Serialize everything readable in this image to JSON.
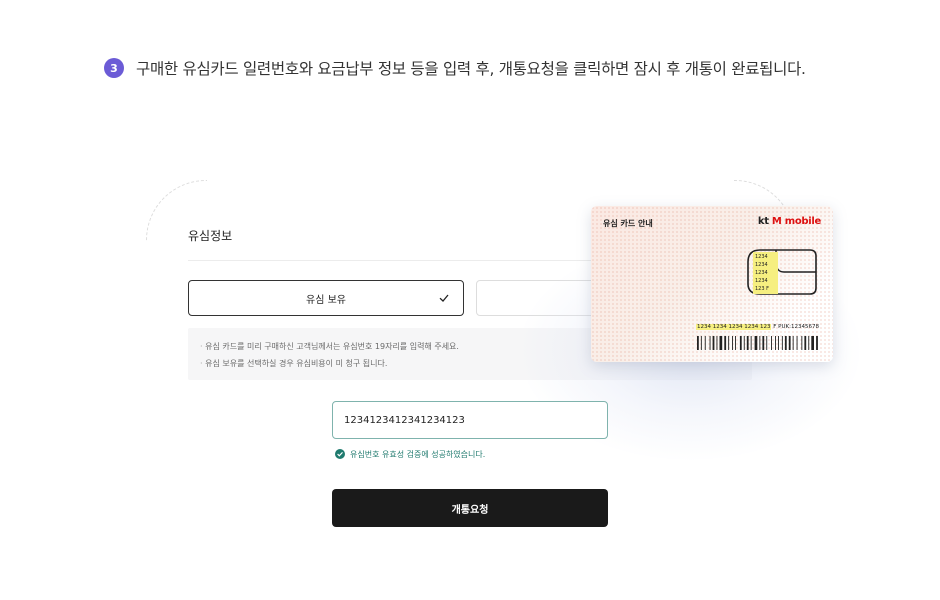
{
  "step": {
    "number": "3",
    "text": "구매한 유심카드 일련번호와 요금납부 정보 등을 입력 후, 개통요청을 클릭하면 잠시 후 개통이 완료됩니다."
  },
  "panel": {
    "title": "유심정보",
    "options": [
      {
        "label": "유심 보유",
        "selected": true
      },
      {
        "label": "",
        "selected": false
      }
    ],
    "notices": [
      "유심 카드를 미리 구매하신 고객님께서는 유심번호 19자리를 입력해 주세요.",
      "유심 보유를 선택하실 경우 유심비용이 미 청구 됩니다."
    ]
  },
  "sim_input": {
    "value": "1234123412341234123"
  },
  "validation": {
    "message": "유심번호 유효성 검증에 성공하였습니다."
  },
  "submit": {
    "label": "개통요청"
  },
  "card": {
    "title": "유심 카드 안내",
    "brand_kt": "kt",
    "brand_name": "M mobile",
    "chip_numbers": [
      "1234",
      "1234",
      "1234",
      "1234",
      "123"
    ],
    "chip_suffix": "F",
    "serial": "1234 1234 1234 1234 123",
    "serial_suffix": "F",
    "puk": "PUK:12345678"
  },
  "colors": {
    "step_badge": "#6b5bd6",
    "valid_text": "#1f7a6e",
    "submit_bg": "#1a1a1a",
    "brand_red": "#dd1111",
    "highlight_yellow": "#f6ef80"
  }
}
